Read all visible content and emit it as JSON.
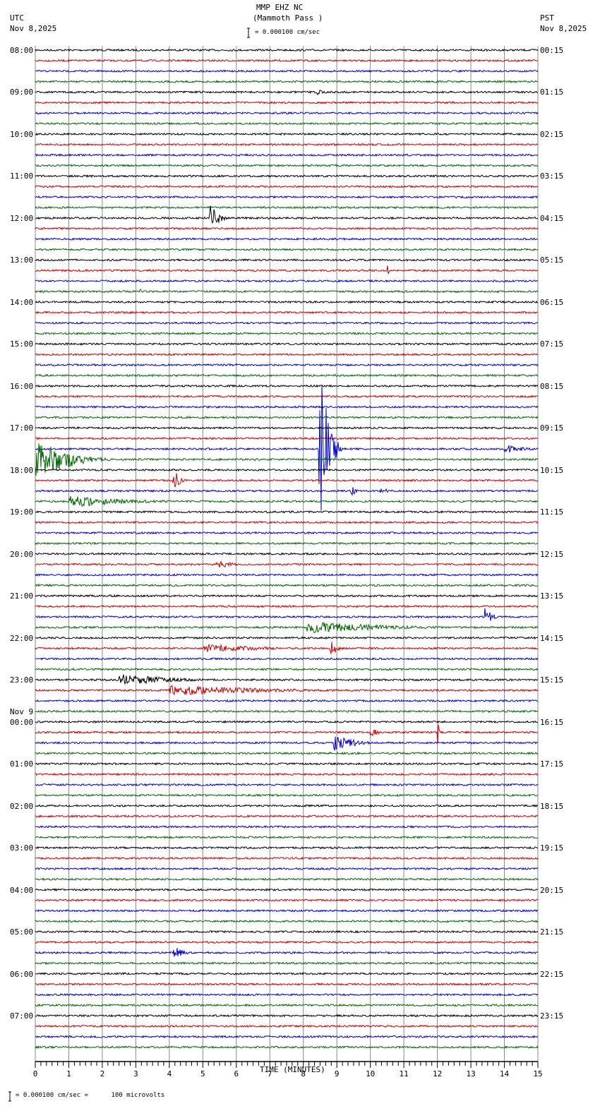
{
  "header": {
    "station": "MMP EHZ NC",
    "location": "(Mammoth Pass )",
    "left_tz": "UTC",
    "left_date": "Nov 8,2025",
    "right_tz": "PST",
    "right_date": "Nov 8,2025",
    "scale": "= 0.000100 cm/sec"
  },
  "footer": {
    "scale": "= 0.000100 cm/sec =      100 microvolts",
    "mark": "x"
  },
  "chart_data": {
    "type": "line",
    "title": "MMP EHZ NC (Mammoth Pass )",
    "xlabel": "TIME (MINUTES)",
    "xlim": [
      0,
      15
    ],
    "xticks": [
      "0",
      "1",
      "2",
      "3",
      "4",
      "5",
      "6",
      "7",
      "8",
      "9",
      "10",
      "11",
      "12",
      "13",
      "14",
      "15"
    ],
    "trace_colors": [
      "#000000",
      "#cc0000",
      "#0000cc",
      "#006600"
    ],
    "traces_per_hour": 4,
    "left_labels": [
      "08:00",
      "09:00",
      "10:00",
      "11:00",
      "12:00",
      "13:00",
      "14:00",
      "15:00",
      "16:00",
      "17:00",
      "18:00",
      "19:00",
      "20:00",
      "21:00",
      "22:00",
      "23:00",
      "00:00",
      "01:00",
      "02:00",
      "03:00",
      "04:00",
      "05:00",
      "06:00",
      "07:00"
    ],
    "date_change_label": "Nov 9",
    "date_change_index": 16,
    "right_labels": [
      "00:15",
      "01:15",
      "02:15",
      "03:15",
      "04:15",
      "05:15",
      "06:15",
      "07:15",
      "08:15",
      "09:15",
      "10:15",
      "11:15",
      "12:15",
      "13:15",
      "14:15",
      "15:15",
      "16:15",
      "17:15",
      "18:15",
      "19:15",
      "20:15",
      "21:15",
      "22:15",
      "23:15"
    ],
    "events": [
      {
        "row": 4,
        "start": 8.4,
        "dur": 0.3,
        "amp": 4
      },
      {
        "row": 16,
        "start": 5.2,
        "dur": 0.6,
        "amp": 22
      },
      {
        "row": 21,
        "start": 10.5,
        "dur": 0.1,
        "amp": 8
      },
      {
        "row": 23,
        "start": 3.1,
        "dur": 0.1,
        "amp": 6
      },
      {
        "row": 38,
        "start": 8.45,
        "dur": 0.8,
        "amp": 120
      },
      {
        "row": 38,
        "start": 14.0,
        "dur": 1.0,
        "amp": 5
      },
      {
        "row": 39,
        "start": 0.0,
        "dur": 2.6,
        "amp": 25
      },
      {
        "row": 41,
        "start": 4.1,
        "dur": 0.4,
        "amp": 18
      },
      {
        "row": 42,
        "start": 9.4,
        "dur": 0.3,
        "amp": 8
      },
      {
        "row": 42,
        "start": 10.3,
        "dur": 0.3,
        "amp": 7
      },
      {
        "row": 43,
        "start": 1.0,
        "dur": 3.4,
        "amp": 7
      },
      {
        "row": 49,
        "start": 5.4,
        "dur": 0.9,
        "amp": 6
      },
      {
        "row": 54,
        "start": 13.4,
        "dur": 0.5,
        "amp": 12
      },
      {
        "row": 55,
        "start": 8.1,
        "dur": 4.6,
        "amp": 7
      },
      {
        "row": 57,
        "start": 5.0,
        "dur": 3.0,
        "amp": 5
      },
      {
        "row": 57,
        "start": 8.8,
        "dur": 0.5,
        "amp": 10
      },
      {
        "row": 60,
        "start": 2.5,
        "dur": 3.0,
        "amp": 7
      },
      {
        "row": 61,
        "start": 4.0,
        "dur": 5.5,
        "amp": 6
      },
      {
        "row": 65,
        "start": 10.0,
        "dur": 0.5,
        "amp": 6
      },
      {
        "row": 65,
        "start": 12.0,
        "dur": 0.1,
        "amp": 22
      },
      {
        "row": 66,
        "start": 8.9,
        "dur": 1.4,
        "amp": 10
      },
      {
        "row": 86,
        "start": 4.1,
        "dur": 0.6,
        "amp": 10
      }
    ]
  }
}
